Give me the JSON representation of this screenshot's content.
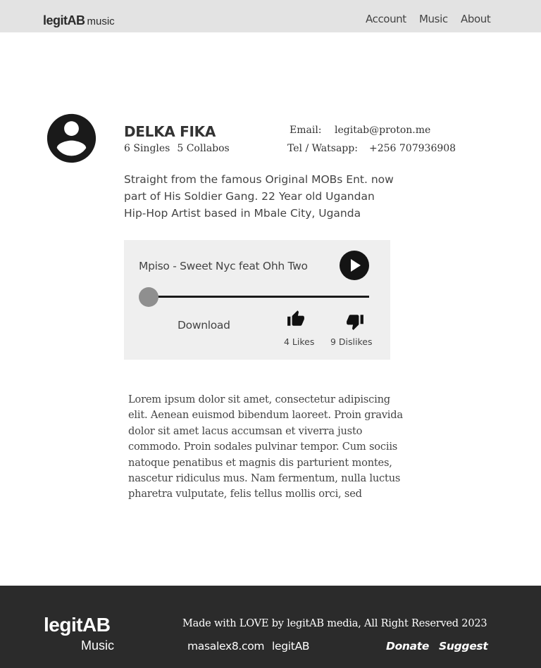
{
  "header": {
    "brand": "legitAB",
    "brand_sub": "music",
    "nav": [
      "Account",
      "Music",
      "About"
    ]
  },
  "profile": {
    "avatar_icon": "account-circle-icon",
    "name": "DELKA FIKA",
    "singles": "6 Singles",
    "collabos": "5 Collabos",
    "email_label": "Email:",
    "email": "legitab@proton.me",
    "tel_label": "Tel / Watsapp:",
    "tel": "+256 707936908",
    "bio": "Straight from the famous Original MOBs Ent. now part of His Soldier Gang. 22 Year old Ugandan Hip-Hop Artist based in Mbale City, Uganda"
  },
  "player": {
    "track_title": "Mpiso - Sweet Nyc feat Ohh Two",
    "progress": 0,
    "download_label": "Download",
    "likes": "4 Likes",
    "dislikes": "9 Dislikes"
  },
  "description": "Lorem ipsum dolor sit amet, consectetur adipiscing elit. Aenean euismod bibendum laoreet. Proin gravida dolor sit amet lacus accumsan et viverra justo commodo. Proin sodales pulvinar tempor. Cum sociis natoque penatibus et magnis dis parturient montes, nascetur ridiculus mus. Nam fermentum, nulla luctus pharetra vulputate, felis tellus mollis orci, sed",
  "footer": {
    "brand": "legitAB",
    "brand_sub": "Music",
    "credit": "Made with LOVE by legitAB media,  All Right Reserved 2023",
    "links": [
      "masalex8.com",
      "legitAB"
    ],
    "actions": [
      "Donate",
      "Suggest"
    ]
  },
  "colors": {
    "header_bg": "#e3e3e3",
    "footer_bg": "#2b2b2b",
    "player_bg": "#efefef",
    "text": "#333333"
  }
}
